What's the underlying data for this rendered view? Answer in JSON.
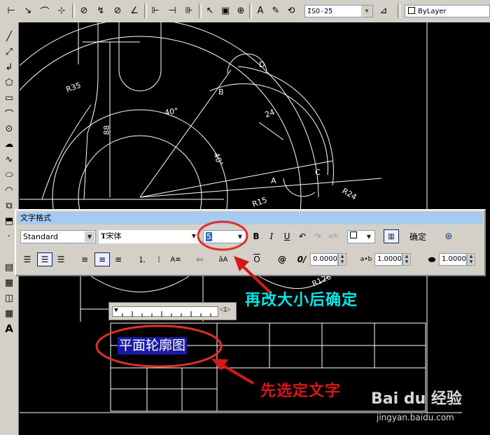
{
  "toolbar": {
    "dimstyle_value": "ISO-25",
    "layer_value": "ByLayer"
  },
  "drawing": {
    "labels": {
      "r35": "R35",
      "d88": "88",
      "angle1": "40°",
      "angle2": "40°",
      "b": "B",
      "d": "D",
      "a": "A",
      "c": "C",
      "d24": "24",
      "r24": "R24",
      "r15": "R15",
      "r126": "R126"
    },
    "selected_text": "平面轮廓图"
  },
  "text_format": {
    "title": "文字格式",
    "style": "Standard",
    "font": "宋体",
    "font_prefix": "T",
    "height": "5",
    "ok_label": "确定",
    "obliquing": "0.0000",
    "tracking": "1.0000",
    "width_factor": "1.0000"
  },
  "annotations": {
    "step2": "再改大小后确定",
    "step1": "先选定文字"
  },
  "watermark": {
    "brand": "Bai du 经验",
    "url": "jingyan.baidu.com"
  },
  "colors": {
    "annotation_cyan": "#00e8e8",
    "annotation_red": "#d41818",
    "highlight_ring": "#e0302a",
    "title_bar": "#a6caf0",
    "selection_bg": "#1a1aa6"
  }
}
